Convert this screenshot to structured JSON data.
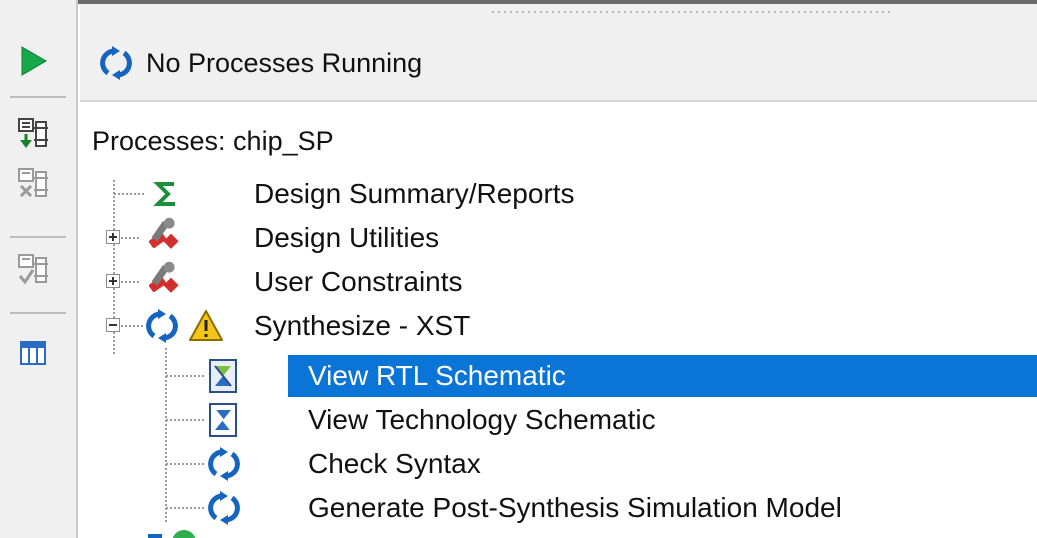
{
  "status": {
    "text": "No Processes Running",
    "icon": "refresh-icon"
  },
  "toolbar": {
    "buttons": [
      {
        "name": "run-icon"
      },
      {
        "name": "add-source-icon"
      },
      {
        "name": "remove-source-icon"
      },
      {
        "name": "check-source-icon"
      },
      {
        "name": "panel-layout-icon"
      }
    ]
  },
  "processes": {
    "title": "Processes: chip_SP",
    "items": [
      {
        "label": "Design Summary/Reports",
        "icon": "sigma-icon",
        "expander": "none"
      },
      {
        "label": "Design Utilities",
        "icon": "tools-icon",
        "expander": "plus"
      },
      {
        "label": "User Constraints",
        "icon": "tools-icon",
        "expander": "plus"
      },
      {
        "label": "Synthesize - XST",
        "icon": "refresh-warning-icon",
        "expander": "minus"
      },
      {
        "label": "View RTL Schematic",
        "icon": "schematic-icon",
        "selected": true
      },
      {
        "label": "View Technology Schematic",
        "icon": "schematic-icon"
      },
      {
        "label": "Check Syntax",
        "icon": "refresh-icon"
      },
      {
        "label": "Generate Post-Synthesis Simulation Model",
        "icon": "refresh-icon"
      }
    ]
  },
  "colors": {
    "selection": "#0b74d7",
    "refresh_blue": "#1565c0",
    "sigma_green": "#1b8f3a",
    "warning_yellow": "#f5c518"
  }
}
